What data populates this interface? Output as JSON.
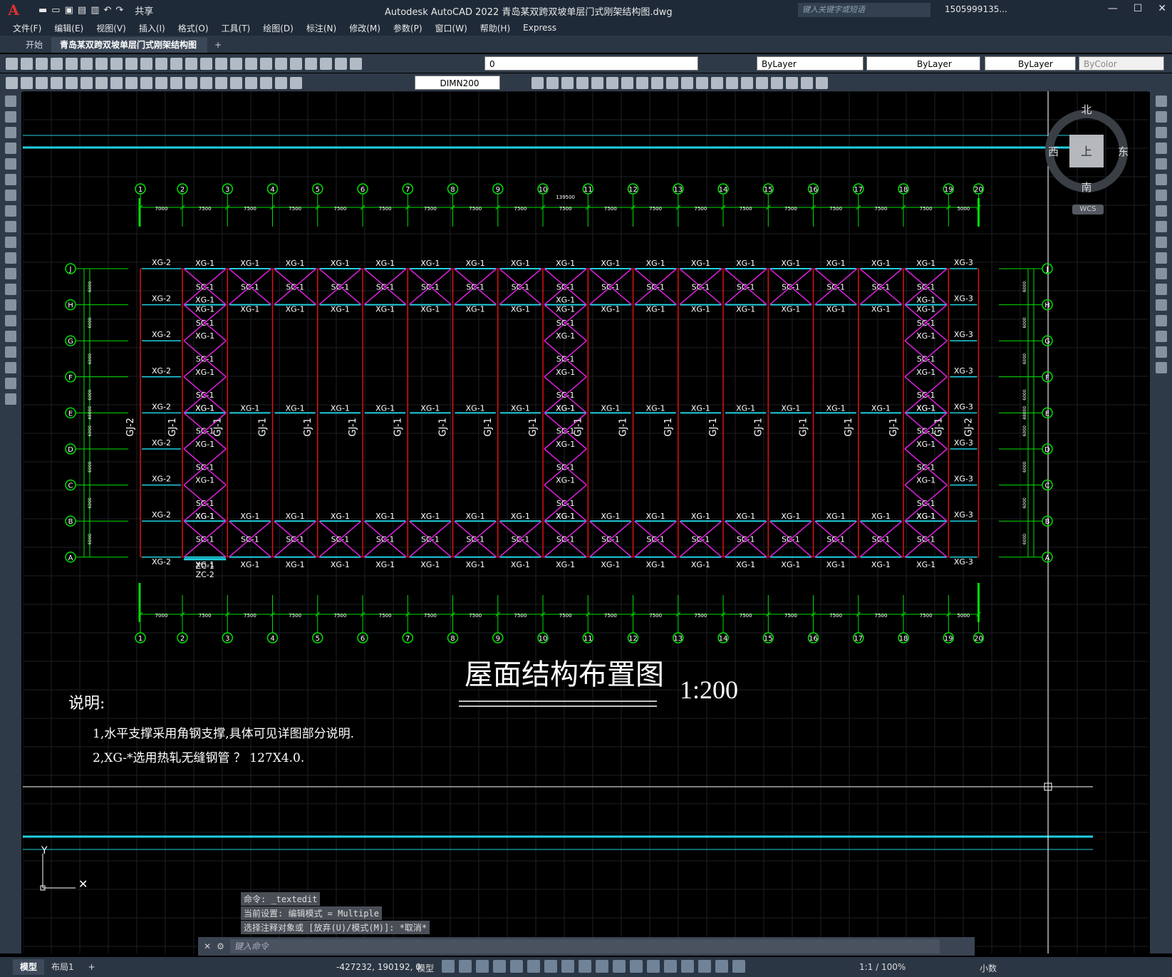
{
  "app": {
    "logo": "A",
    "title": "Autodesk AutoCAD 2022    青岛某双跨双坡单层门式刚架结构图.dwg",
    "share": "共享",
    "search_placeholder": "键入关键字或短语",
    "user": "1505999135...",
    "window_buttons": [
      "—",
      "☐",
      "✕"
    ]
  },
  "menu": [
    "文件(F)",
    "编辑(E)",
    "视图(V)",
    "插入(I)",
    "格式(O)",
    "工具(T)",
    "绘图(D)",
    "标注(N)",
    "修改(M)",
    "参数(P)",
    "窗口(W)",
    "帮助(H)",
    "Express"
  ],
  "tabs": {
    "start": "开始",
    "active": "青岛某双跨双坡单层门式刚架结构图*",
    "close": "✕",
    "plus": "+"
  },
  "toolbar": {
    "layer": "0",
    "color": "ByLayer",
    "linetype": "ByLayer",
    "lineweight": "ByLayer",
    "plotstyle": "ByColor",
    "dimstyle": "DIMN200"
  },
  "viewcube": {
    "north": "北",
    "south": "南",
    "west": "西",
    "east": "东",
    "top": "上",
    "wcs": "WCS"
  },
  "drawing": {
    "col_labels": [
      "1",
      "2",
      "3",
      "4",
      "5",
      "6",
      "7",
      "8",
      "9",
      "10",
      "11",
      "12",
      "13",
      "14",
      "15",
      "16",
      "17",
      "18",
      "19",
      "20"
    ],
    "row_labels": [
      "J",
      "H",
      "G",
      "F",
      "E",
      "D",
      "C",
      "B",
      "A"
    ],
    "spans": [
      "7000",
      "7500",
      "7500",
      "7500",
      "7500",
      "7500",
      "7500",
      "7500",
      "7500",
      "7500",
      "7500",
      "7500",
      "7500",
      "7500",
      "7500",
      "7500",
      "7500",
      "7500",
      "5000"
    ],
    "total_span": "139500",
    "row_dims": [
      "6000",
      "6000",
      "6000",
      "6000",
      "6000",
      "6000",
      "6000",
      "6000"
    ],
    "total_depth": "48000",
    "frame_labels": {
      "gj1": "GJ-1",
      "gj2": "GJ-2"
    },
    "beam_labels": {
      "xg1": "XG-1",
      "xg2": "XG-2",
      "xg3": "XG-3",
      "sc1": "SC-1",
      "zc1": "ZC-1",
      "zc2": "ZC-2"
    },
    "title": "屋面结构布置图",
    "scale": "1:200",
    "notes_heading": "说明:",
    "notes": [
      "1,水平支撑采用角钢支撑,具体可见详图部分说明.",
      "2,XG-*选用热轧无缝钢管 ？ 127X4.0."
    ]
  },
  "ucs": {
    "y": "Y",
    "x": "✕"
  },
  "command": {
    "history": [
      "命令: _textedit",
      "当前设置: 编辑模式 = Multiple",
      "选择注释对象或 [放弃(U)/模式(M)]: *取消*"
    ],
    "placeholder": "键入命令"
  },
  "status": {
    "model_tab": "模型",
    "layout_tab": "布局1",
    "plus": "+",
    "coords": "-427232, 190192, 0",
    "model": "模型",
    "scale": "1:1 / 100%",
    "units": "小数"
  },
  "colors": {
    "grid_green": "#00e000",
    "frame_red": "#e01010",
    "brace_magenta": "#e020e0",
    "beam_cyan": "#20d0e0",
    "text_white": "#ffffff"
  }
}
